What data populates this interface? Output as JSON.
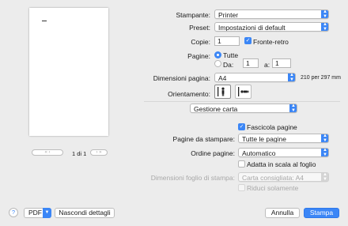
{
  "preview": {
    "page_label": "1 di 1",
    "nav_first": "«",
    "nav_prev": "‹",
    "nav_next": "›",
    "nav_last": "»"
  },
  "printer": {
    "label": "Stampante:",
    "value": "Printer"
  },
  "preset": {
    "label": "Preset:",
    "value": "Impostazioni di default"
  },
  "copies": {
    "label": "Copie:",
    "value": "1",
    "duplex_label": "Fronte-retro",
    "duplex_checked": true
  },
  "pages": {
    "label": "Pagine:",
    "all_label": "Tutte",
    "from_label": "Da:",
    "from_value": "1",
    "to_label": "a:",
    "to_value": "1"
  },
  "paper_size": {
    "label": "Dimensioni pagina:",
    "value": "A4",
    "dims": "210 per 297 mm"
  },
  "orientation": {
    "label": "Orientamento:"
  },
  "section": {
    "value": "Gestione carta"
  },
  "collate": {
    "label": "Fascicola pagine",
    "checked": true
  },
  "pages_to_print": {
    "label": "Pagine da stampare:",
    "value": "Tutte le pagine"
  },
  "page_order": {
    "label": "Ordine pagine:",
    "value": "Automatico"
  },
  "scale": {
    "label": "Adatta in scala al foglio",
    "checked": false
  },
  "dest_paper": {
    "label": "Dimensioni foglio di stampa:",
    "value": "Carta consigliata: A4"
  },
  "scale_down": {
    "label": "Riduci solamente"
  },
  "footer": {
    "help": "?",
    "pdf": "PDF",
    "hide_details": "Nascondi dettagli",
    "cancel": "Annulla",
    "print": "Stampa"
  },
  "colors": {
    "accent": "#3b86f6",
    "background": "#ececec"
  }
}
